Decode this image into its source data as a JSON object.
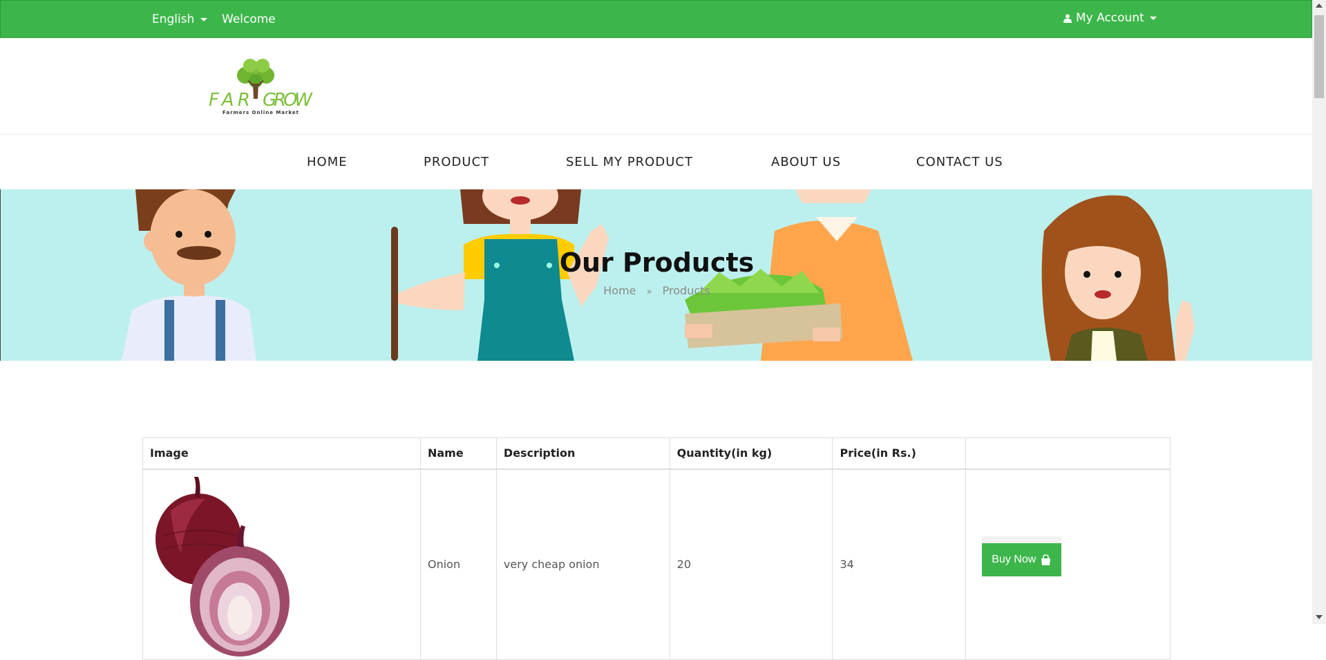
{
  "topbar": {
    "language": "English",
    "welcome": "Welcome",
    "account": "My Account",
    "account_icon": "user-icon",
    "color": "#3cb64a"
  },
  "logo": {
    "brand": "FARMGROW",
    "tagline": "Farmers Online Market"
  },
  "nav": {
    "items": [
      "HOME",
      "PRODUCT",
      "SELL MY PRODUCT",
      "ABOUT US",
      "CONTACT US"
    ]
  },
  "banner": {
    "title": "Our Products",
    "breadcrumb_home": "Home",
    "breadcrumb_sep_icon": "double-chevron-right-icon",
    "breadcrumb_current": "Products"
  },
  "table": {
    "headers": [
      "Image",
      "Name",
      "Description",
      "Quantity(in kg)",
      "Price(in Rs.)",
      ""
    ],
    "rows": [
      {
        "image_icon": "onion-image",
        "name": "Onion",
        "description": "very cheap onion",
        "quantity": "20",
        "price": "34",
        "action": "Buy Now",
        "action_icon": "shopping-bag-icon"
      }
    ]
  }
}
